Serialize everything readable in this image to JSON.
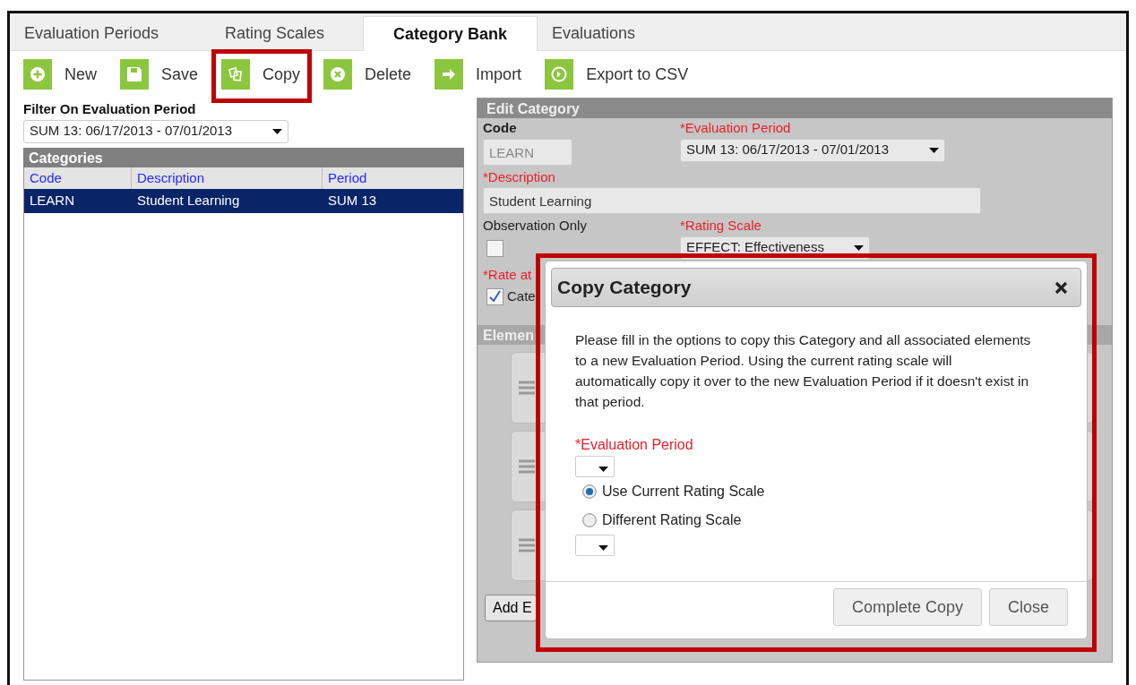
{
  "tabs": [
    {
      "label": "Evaluation Periods",
      "selected": false
    },
    {
      "label": "Rating Scales",
      "selected": false
    },
    {
      "label": "Category Bank",
      "selected": true
    },
    {
      "label": "Evaluations",
      "selected": false
    }
  ],
  "toolbar": [
    {
      "kind": "new",
      "label": "New",
      "highlighted": false
    },
    {
      "kind": "save",
      "label": "Save",
      "highlighted": false
    },
    {
      "kind": "copy",
      "label": "Copy",
      "highlighted": true
    },
    {
      "kind": "delete",
      "label": "Delete",
      "highlighted": false
    },
    {
      "kind": "import",
      "label": "Import",
      "highlighted": false
    },
    {
      "kind": "export",
      "label": "Export to CSV",
      "highlighted": false
    }
  ],
  "filter": {
    "label": "Filter On Evaluation Period",
    "value": "SUM 13: 06/17/2013 - 07/01/2013"
  },
  "categories": {
    "title": "Categories",
    "columns": [
      "Code",
      "Description",
      "Period"
    ],
    "rows": [
      {
        "code": "LEARN",
        "description": "Student Learning",
        "period": "SUM 13",
        "selected": true
      }
    ]
  },
  "edit_category": {
    "title": "Edit Category",
    "code": {
      "label": "Code",
      "required": false,
      "value": "LEARN",
      "disabled": true
    },
    "evaluation_period": {
      "label": "*Evaluation Period",
      "required": true,
      "value": "SUM 13: 06/17/2013 - 07/01/2013"
    },
    "description": {
      "label": "*Description",
      "required": true,
      "value": "Student Learning"
    },
    "observation_only": {
      "label": "Observation Only",
      "required": false,
      "checked": false
    },
    "rating_scale": {
      "label": "*Rating Scale",
      "required": true,
      "value": "EFFECT: Effectiveness"
    },
    "rate_at": {
      "label": "*Rate at",
      "required": true,
      "option": "Cate",
      "checked": true
    },
    "elements": {
      "title": "Elemen",
      "rows": [
        {
          "kind": "element"
        },
        {
          "kind": "element"
        },
        {
          "kind": "element"
        }
      ]
    },
    "add_button": "Add E"
  },
  "modal": {
    "title": "Copy Category",
    "highlighted": true,
    "message": "Please fill in the options to copy this Category and all associated elements to a new Evaluation Period. Using the current rating scale will automatically copy it over to the new Evaluation Period if it doesn't exist in that period.",
    "period_label": "*Evaluation Period",
    "period_required": true,
    "options": [
      {
        "label": "Use Current Rating Scale",
        "selected": true
      },
      {
        "label": "Different Rating Scale",
        "selected": false
      }
    ],
    "buttons": [
      "Complete Copy",
      "Close"
    ]
  }
}
